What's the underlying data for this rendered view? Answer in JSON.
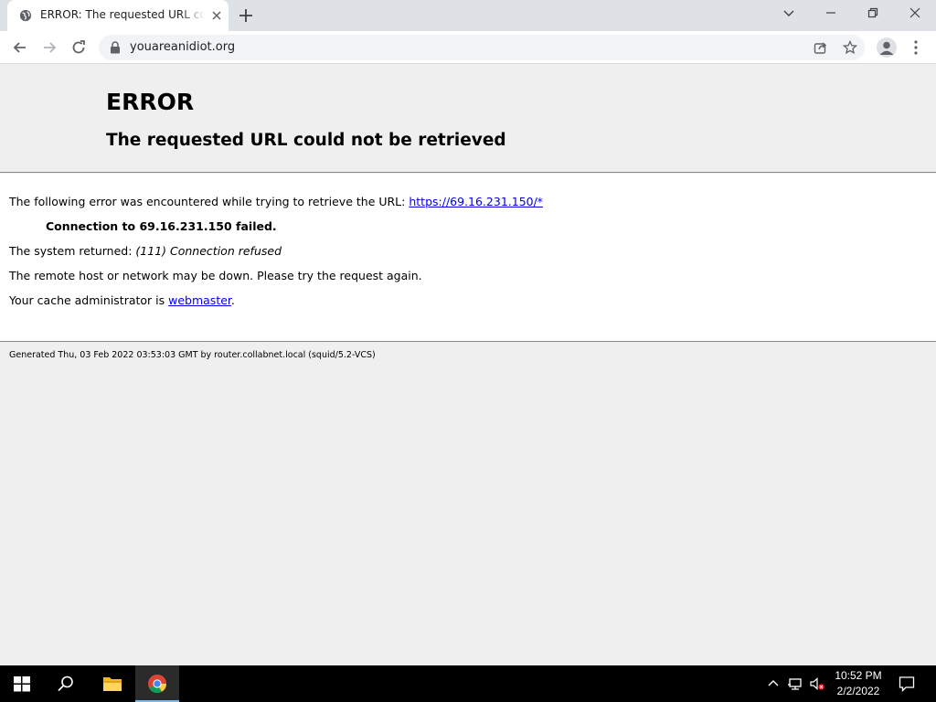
{
  "browser": {
    "tab": {
      "title": "ERROR: The requested URL could not be retrieved",
      "favicon": "globe-icon"
    },
    "address_bar": {
      "url": "youareanidiot.org"
    }
  },
  "page": {
    "title": "ERROR",
    "subtitle": "The requested URL could not be retrieved",
    "line1_text": "The following error was encountered while trying to retrieve the URL: ",
    "line1_link": "https://69.16.231.150/*",
    "line2": "Connection to 69.16.231.150 failed.",
    "line3_text": "The system returned: ",
    "line3_em": "(111) Connection refused",
    "line4": "The remote host or network may be down. Please try the request again.",
    "line5_text": "Your cache administrator is ",
    "line5_link": "webmaster",
    "line5_end": ".",
    "footer": "Generated Thu, 03 Feb 2022 03:53:03 GMT by router.collabnet.local (squid/5.2-VCS)"
  },
  "taskbar": {
    "time": "10:52 PM",
    "date": "2/2/2022"
  },
  "colors": {
    "link": "#0000ee",
    "taskbar": "#000000",
    "tab_strip": "#dee1e6"
  }
}
